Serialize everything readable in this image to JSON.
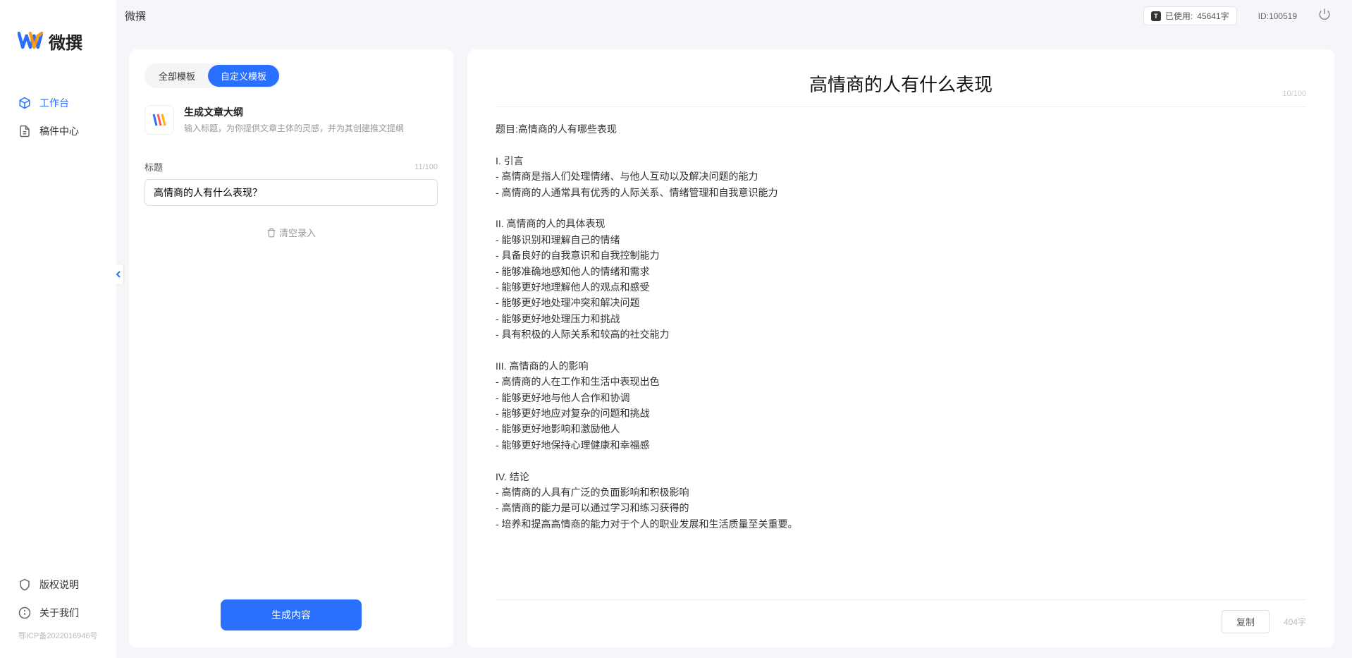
{
  "app": {
    "name": "微撰",
    "logo_text": "微撰"
  },
  "sidebar": {
    "nav": [
      {
        "label": "工作台",
        "active": true
      },
      {
        "label": "稿件中心",
        "active": false
      }
    ],
    "bottom": [
      {
        "label": "版权说明"
      },
      {
        "label": "关于我们"
      }
    ],
    "icp": "鄂ICP备2022016946号"
  },
  "topbar": {
    "usage_prefix": "已使用:",
    "usage_value": "45641字",
    "id_label": "ID:100519"
  },
  "left_panel": {
    "tabs": [
      {
        "label": "全部模板",
        "active": false
      },
      {
        "label": "自定义模板",
        "active": true
      }
    ],
    "template": {
      "name": "生成文章大纲",
      "desc": "输入标题，为你提供文章主体的灵感，并为其创建推文提纲"
    },
    "field": {
      "label": "标题",
      "counter": "11/100",
      "value": "高情商的人有什么表现？"
    },
    "clear": "清空录入",
    "generate": "生成内容"
  },
  "right_panel": {
    "title": "高情商的人有什么表现",
    "title_counter": "10/100",
    "body": "题目:高情商的人有哪些表现\n\nI. 引言\n- 高情商是指人们处理情绪、与他人互动以及解决问题的能力\n- 高情商的人通常具有优秀的人际关系、情绪管理和自我意识能力\n\nII. 高情商的人的具体表现\n- 能够识别和理解自己的情绪\n- 具备良好的自我意识和自我控制能力\n- 能够准确地感知他人的情绪和需求\n- 能够更好地理解他人的观点和感受\n- 能够更好地处理冲突和解决问题\n- 能够更好地处理压力和挑战\n- 具有积极的人际关系和较高的社交能力\n\nIII. 高情商的人的影响\n- 高情商的人在工作和生活中表现出色\n- 能够更好地与他人合作和协调\n- 能够更好地应对复杂的问题和挑战\n- 能够更好地影响和激励他人\n- 能够更好地保持心理健康和幸福感\n\nIV. 结论\n- 高情商的人具有广泛的负面影响和积极影响\n- 高情商的能力是可以通过学习和练习获得的\n- 培养和提高高情商的能力对于个人的职业发展和生活质量至关重要。",
    "copy": "复制",
    "word_count": "404字"
  }
}
